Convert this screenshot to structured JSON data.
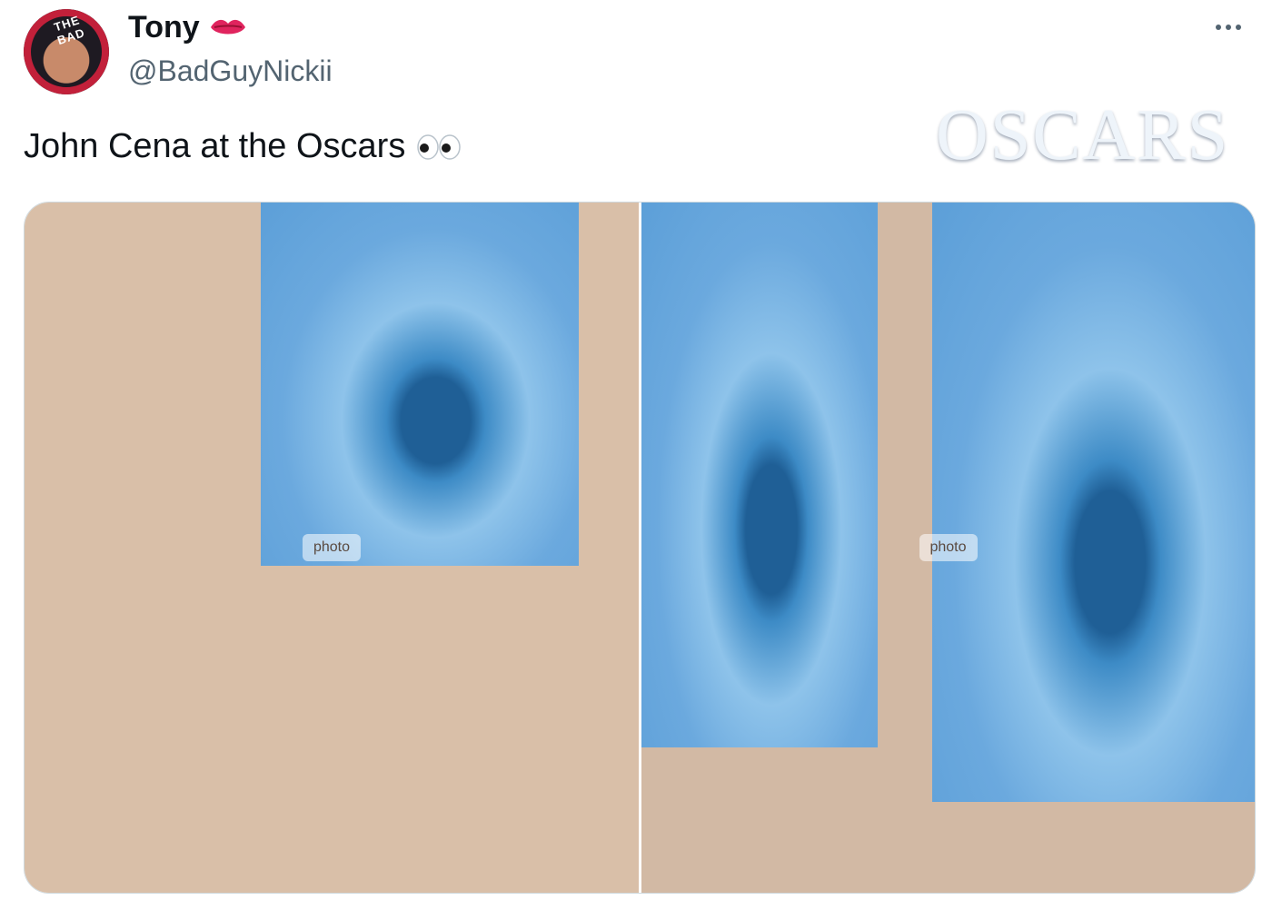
{
  "author": {
    "display_name": "Tony",
    "handle": "@BadGuyNickii",
    "avatar_ring_text": "THE BAD",
    "name_emoji": "kiss-mark-icon"
  },
  "tweet": {
    "text": "John Cena at the Oscars",
    "emoji": "eyes-icon"
  },
  "media": {
    "count": 2,
    "photos": [
      {
        "position": "left"
      },
      {
        "position": "right",
        "sign_text": "OSCARS"
      }
    ]
  },
  "colors": {
    "name": "#0f1419",
    "handle": "#536471",
    "border": "#cfd9de",
    "backdrop_blue": "#5c9fd8",
    "kiss_red": "#e0245e"
  }
}
